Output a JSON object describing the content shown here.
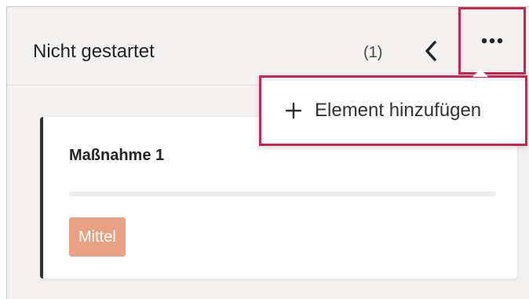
{
  "column": {
    "title": "Nicht gestartet",
    "count": "(1)",
    "collapse_icon": "chevron-left-icon",
    "more_icon": "more-horizontal-icon"
  },
  "menu": {
    "items": [
      {
        "icon": "plus-icon",
        "label": "Element hinzufügen"
      }
    ]
  },
  "card": {
    "title": "Maßnahme 1",
    "progress": 0,
    "priority": "Mittel",
    "priority_color": "#e8a283",
    "accent_color": "#323130"
  },
  "colors": {
    "highlight": "#c8264f",
    "column_bg": "#f3f2f1"
  }
}
